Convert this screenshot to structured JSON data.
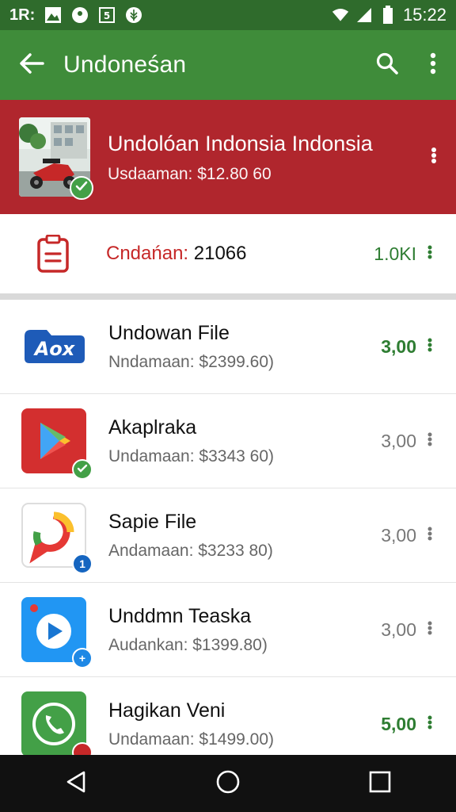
{
  "status_bar": {
    "left_text": "1R:",
    "time": "15:22",
    "icons": [
      "image-icon",
      "location-icon",
      "sim-icon",
      "leaf-icon",
      "wifi-icon",
      "signal-icon",
      "battery-icon"
    ]
  },
  "app_bar": {
    "title": "Undoneśan",
    "icons": [
      "back-arrow-icon",
      "search-icon",
      "more-vert-icon"
    ]
  },
  "featured": {
    "title": "Undolóan Indonsia Indonsia",
    "subtitle": "Usdaaman: $12.80 60",
    "colors": {
      "background": "#b0262d",
      "badge": "#43a047"
    },
    "icons": [
      "scooter-photo",
      "check-icon",
      "more-vert-icon"
    ]
  },
  "summary": {
    "label": "Cndańan:",
    "number": "21066",
    "value": "1.0KI",
    "icon": "clipboard-icon",
    "colors": {
      "label": "#c62828",
      "value": "#2e7d32"
    }
  },
  "list": [
    {
      "title": "Undowan File",
      "subtitle": "Nndamaan: $2399.60)",
      "value": "3,00",
      "value_green": true,
      "icon": "aox-logo-icon",
      "badge": "",
      "logo_text": "Aox"
    },
    {
      "title": "Akaplraka",
      "subtitle": "Undamaan: $3343 60)",
      "value": "3,00",
      "value_green": false,
      "icon": "play-store-icon",
      "badge": "check"
    },
    {
      "title": "Sapie File",
      "subtitle": "Andamaan: $3233 80)",
      "value": "3,00",
      "value_green": false,
      "icon": "maps-pin-icon",
      "badge": "1"
    },
    {
      "title": "Unddmn Teaska",
      "subtitle": "Audankan: $1399.80)",
      "value": "3,00",
      "value_green": false,
      "icon": "video-play-icon",
      "badge": "+"
    },
    {
      "title": "Hagikan Veni",
      "subtitle": "Undamaan: $1499.00)",
      "value": "5,00",
      "value_green": true,
      "icon": "whatsapp-phone-icon",
      "badge": ""
    }
  ],
  "nav_bar": {
    "icons": [
      "back-triangle-icon",
      "home-circle-icon",
      "recents-square-icon"
    ]
  }
}
